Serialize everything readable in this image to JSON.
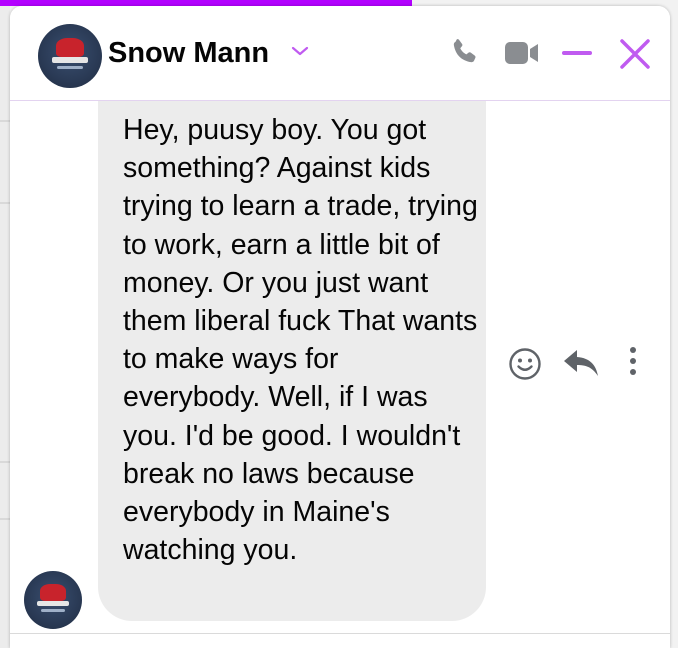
{
  "header": {
    "contact_name": "Snow Mann",
    "icons": [
      "phone-icon",
      "video-icon",
      "minimize-icon",
      "close-icon",
      "chevron-down-icon"
    ]
  },
  "message": {
    "text": "Hey, puusy boy. You got something? Against kids trying to learn a trade, trying to work, earn a little bit of money. Or you just want them liberal fuck That wants to make ways for everybody. Well, if I was you. I'd be good. I wouldn't break no laws because everybody in Maine's watching you.",
    "actions": [
      "smiley-icon",
      "reply-icon",
      "more-options-icon"
    ]
  },
  "colors": {
    "accent": "#b300ff",
    "header_icon_accent": "#c05bf0",
    "gray_icon": "#8a8d91",
    "bubble": "#ececec",
    "text": "#050505"
  }
}
